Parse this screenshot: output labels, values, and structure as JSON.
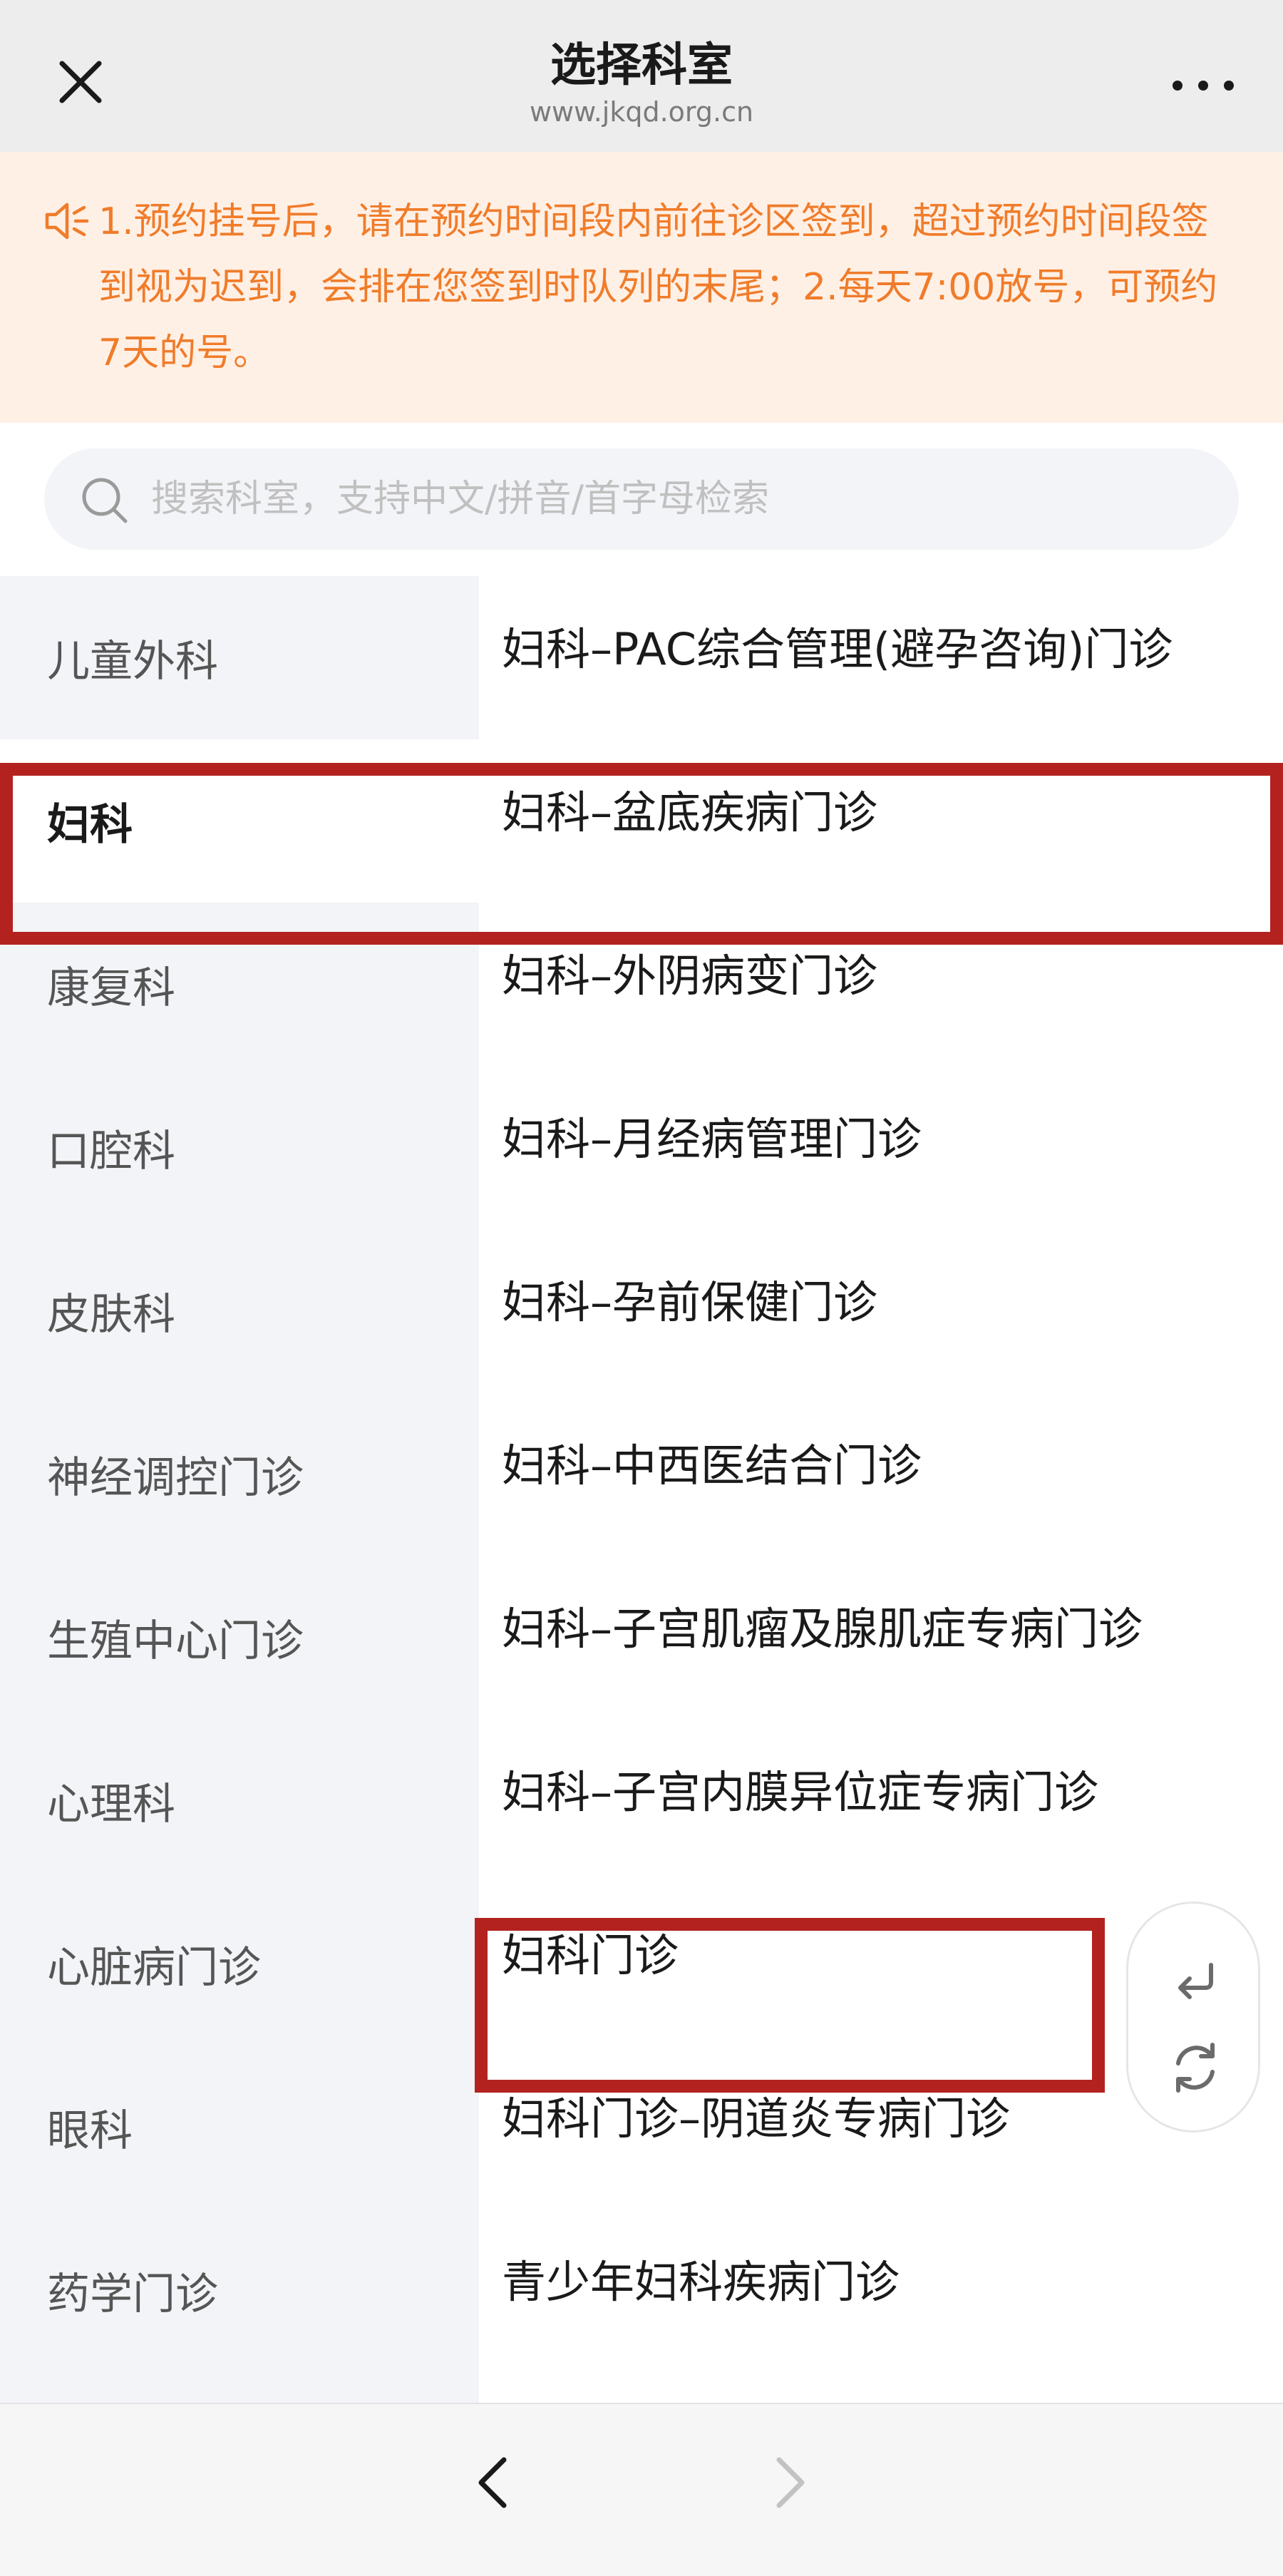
{
  "header": {
    "title": "选择科室",
    "url": "www.jkqd.org.cn"
  },
  "notice": {
    "text": "1.预约挂号后，请在预约时间段内前往诊区签到，超过预约时间段签到视为迟到，会排在您签到时队列的末尾；2.每天7:00放号，可预约7天的号。"
  },
  "search": {
    "placeholder": "搜索科室，支持中文/拼音/首字母检索"
  },
  "sidebar": {
    "items": [
      {
        "label": "儿童外科"
      },
      {
        "label": "妇科",
        "active": true
      },
      {
        "label": "康复科"
      },
      {
        "label": "口腔科"
      },
      {
        "label": "皮肤科"
      },
      {
        "label": "神经调控门诊"
      },
      {
        "label": "生殖中心门诊"
      },
      {
        "label": "心理科"
      },
      {
        "label": "心脏病门诊"
      },
      {
        "label": "眼科"
      },
      {
        "label": "药学门诊"
      }
    ]
  },
  "departments": {
    "items": [
      {
        "label": "妇科–PAC综合管理(避孕咨询)门诊"
      },
      {
        "label": "妇科–盆底疾病门诊"
      },
      {
        "label": "妇科–外阴病变门诊"
      },
      {
        "label": "妇科–月经病管理门诊"
      },
      {
        "label": "妇科–孕前保健门诊"
      },
      {
        "label": "妇科–中西医结合门诊"
      },
      {
        "label": "妇科–子宫肌瘤及腺肌症专病门诊"
      },
      {
        "label": "妇科–子宫内膜异位症专病门诊"
      },
      {
        "label": "妇科门诊"
      },
      {
        "label": "妇科门诊–阴道炎专病门诊"
      },
      {
        "label": "青少年妇科疾病门诊"
      }
    ]
  },
  "floating_tools": {
    "icons": [
      "return-icon",
      "refresh-icon"
    ]
  },
  "bottom_nav": {
    "icons": [
      "back-chevron-icon",
      "forward-chevron-icon"
    ],
    "forward_enabled": false
  },
  "colors": {
    "notice_text": "#f07c2a",
    "notice_bg": "#fff0e6",
    "highlight_border": "#b3221f",
    "sidebar_bg": "#f3f4f7"
  }
}
